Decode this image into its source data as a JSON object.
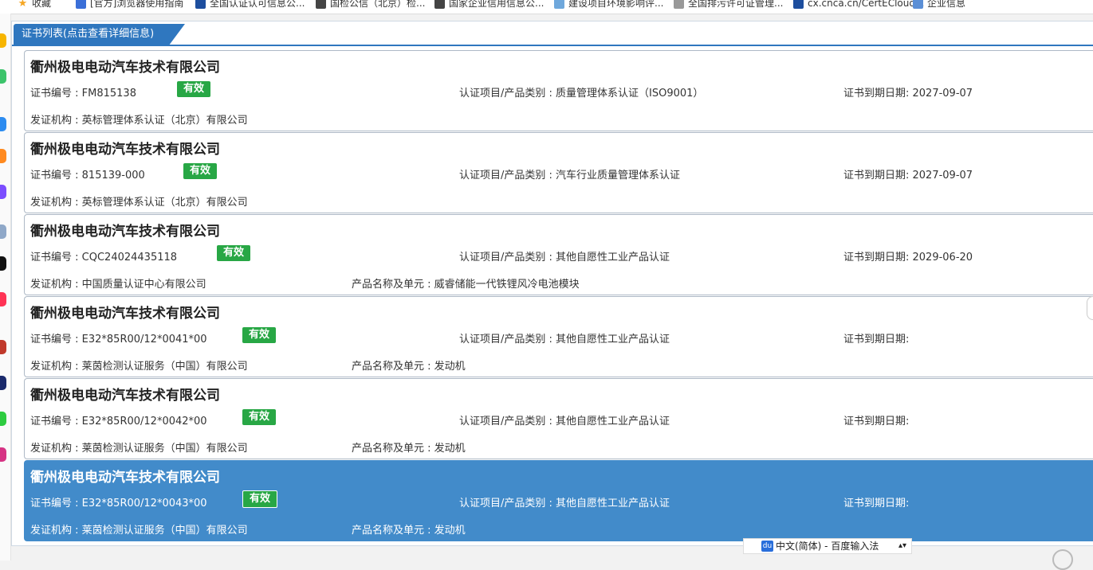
{
  "bookmarks": [
    {
      "label": "收藏",
      "icon": "star-icon",
      "color": "#f5a623"
    },
    {
      "label": "[官方]浏览器使用指南",
      "icon": "doc-icon",
      "color": "#3a6fd8"
    },
    {
      "label": "全国认证认可信息公...",
      "icon": "site-icon",
      "color": "#1d4e9e"
    },
    {
      "label": "国检公信（北京）检...",
      "icon": "globe-icon",
      "color": "#444444"
    },
    {
      "label": "国家企业信用信息公...",
      "icon": "globe-icon",
      "color": "#444444"
    },
    {
      "label": "建设项目环境影响评...",
      "icon": "leaf-icon",
      "color": "#6fa8dc"
    },
    {
      "label": "全国排污许可证管理...",
      "icon": "gear-icon",
      "color": "#999999"
    },
    {
      "label": "cx.cnca.cn/CertECloud...",
      "icon": "site-icon",
      "color": "#1d4e9e"
    },
    {
      "label": "企业信息",
      "icon": "hs-icon",
      "color": "#5b8fd6"
    }
  ],
  "panel": {
    "tab_label": "证书列表(点击查看详细信息)"
  },
  "labels": {
    "cert_no": "证书编号 : ",
    "project": "认证项目/产品类别 : ",
    "expiry": "证书到期日期: ",
    "issuer": "发证机构 : ",
    "product": "产品名称及单元 : "
  },
  "certificates": [
    {
      "company": "衢州极电电动汽车技术有限公司",
      "cert_no": "FM815138",
      "status": "有效",
      "project": "质量管理体系认证（ISO9001）",
      "expiry": "2027-09-07",
      "issuer": "英标管理体系认证（北京）有限公司",
      "product": ""
    },
    {
      "company": "衢州极电电动汽车技术有限公司",
      "cert_no": "815139-000",
      "status": "有效",
      "project": "汽车行业质量管理体系认证",
      "expiry": "2027-09-07",
      "issuer": "英标管理体系认证（北京）有限公司",
      "product": ""
    },
    {
      "company": "衢州极电电动汽车技术有限公司",
      "cert_no": "CQC24024435118",
      "status": "有效",
      "project": "其他自愿性工业产品认证",
      "expiry": "2029-06-20",
      "issuer": "中国质量认证中心有限公司",
      "product": "威睿储能一代铁锂风冷电池模块"
    },
    {
      "company": "衢州极电电动汽车技术有限公司",
      "cert_no": "E32*85R00/12*0041*00",
      "status": "有效",
      "project": "其他自愿性工业产品认证",
      "expiry": "",
      "issuer": "莱茵检测认证服务（中国）有限公司",
      "product": "发动机"
    },
    {
      "company": "衢州极电电动汽车技术有限公司",
      "cert_no": "E32*85R00/12*0042*00",
      "status": "有效",
      "project": "其他自愿性工业产品认证",
      "expiry": "",
      "issuer": "莱茵检测认证服务（中国）有限公司",
      "product": "发动机"
    },
    {
      "company": "衢州极电电动汽车技术有限公司",
      "cert_no": "E32*85R00/12*0043*00",
      "status": "有效",
      "project": "其他自愿性工业产品认证",
      "expiry": "",
      "issuer": "莱茵检测认证服务（中国）有限公司",
      "product": "发动机",
      "selected": true
    }
  ],
  "ime": {
    "label": "中文(简体) - 百度输入法",
    "badge": "du"
  },
  "colors": {
    "accent": "#2f77bf",
    "selected": "#428bca",
    "status_valid": "#28a745"
  }
}
